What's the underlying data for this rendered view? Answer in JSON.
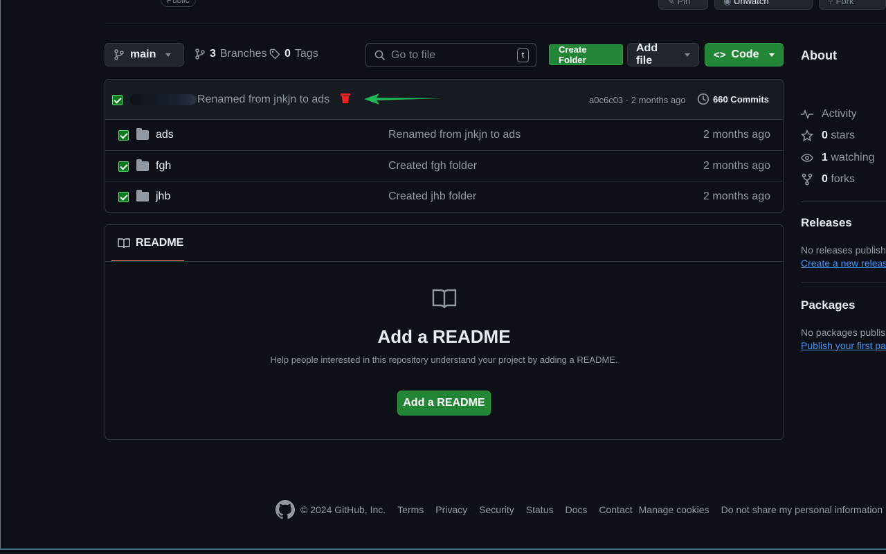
{
  "top": {
    "visibility_badge": "Public",
    "pin_label": "Pin",
    "watch_label": "Unwatch",
    "fork_label": "Fork"
  },
  "toolbar": {
    "branch": "main",
    "branches_count": "3",
    "branches_label": "Branches",
    "tags_count": "0",
    "tags_label": "Tags",
    "search_placeholder": "Go to file",
    "search_shortcut": "t",
    "create_folder": "Create Folder",
    "add_file": "Add file",
    "code": "Code"
  },
  "latest_commit": {
    "message": "Renamed from jnkjn to ads",
    "hash": "a0c6c03",
    "separator": "·",
    "age": "2 months ago",
    "commits_label": "660 Commits"
  },
  "files": [
    {
      "name": "ads",
      "message": "Renamed from jnkjn to ads",
      "age": "2 months ago"
    },
    {
      "name": "fgh",
      "message": "Created fgh folder",
      "age": "2 months ago"
    },
    {
      "name": "jhb",
      "message": "Created jhb folder",
      "age": "2 months ago"
    }
  ],
  "readme": {
    "tab_label": "README",
    "heading": "Add a README",
    "description": "Help people interested in this repository understand your project by adding a README.",
    "button": "Add a README"
  },
  "sidebar": {
    "about": "About",
    "activity": "Activity",
    "stars_count": "0",
    "stars_label": "stars",
    "watching_count": "1",
    "watching_label": "watching",
    "forks_count": "0",
    "forks_label": "forks",
    "releases_heading": "Releases",
    "releases_text": "No releases published",
    "releases_link": "Create a new release",
    "packages_heading": "Packages",
    "packages_text": "No packages published",
    "packages_link": "Publish your first package"
  },
  "footer": {
    "copyright": "© 2024 GitHub, Inc.",
    "links": [
      "Terms",
      "Privacy",
      "Security",
      "Status",
      "Docs",
      "Contact",
      "Manage cookies",
      "Do not share my personal information"
    ]
  },
  "colors": {
    "background": "#0d1117",
    "primary_green": "#238636",
    "delete_red": "#ff2020",
    "arrow_green": "#1db954",
    "link_blue": "#4493f8",
    "tab_underline": "#f78166"
  },
  "icons": [
    "branch-icon",
    "tag-icon",
    "search-icon",
    "code-icon",
    "history-icon",
    "folder-icon",
    "book-icon",
    "pulse-icon",
    "star-icon",
    "eye-icon",
    "fork-icon",
    "github-logo-icon",
    "trash-icon",
    "arrow-left-icon"
  ]
}
